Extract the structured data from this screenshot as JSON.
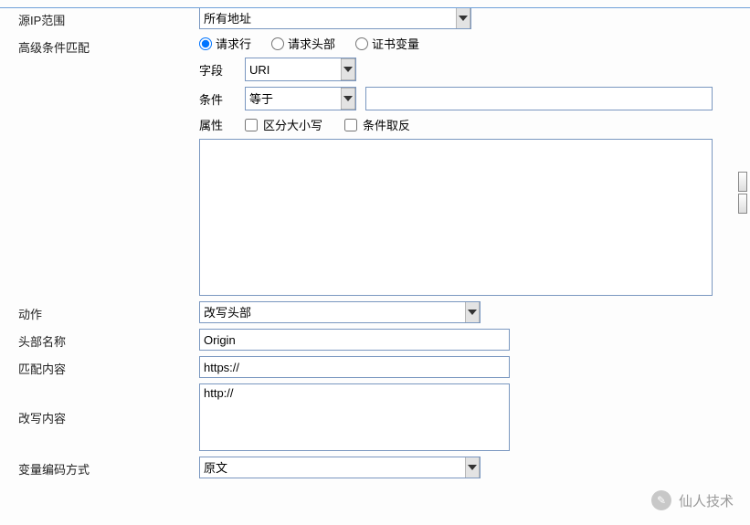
{
  "rows": {
    "ipRange": {
      "label": "源IP范围",
      "value": "所有地址"
    },
    "advMatch": {
      "label": "高级条件匹配",
      "radios": {
        "reqLine": "请求行",
        "reqHeader": "请求头部",
        "certVar": "证书变量"
      },
      "selectedRadio": "reqLine",
      "field": {
        "label": "字段",
        "value": "URI"
      },
      "cond": {
        "label": "条件",
        "value": "等于",
        "input": ""
      },
      "attr": {
        "label": "属性",
        "caseSensitive": "区分大小写",
        "negate": "条件取反"
      },
      "listbox": ""
    },
    "action": {
      "label": "动作",
      "value": "改写头部"
    },
    "headerName": {
      "label": "头部名称",
      "value": "Origin"
    },
    "matchText": {
      "label": "匹配内容",
      "value": "https://"
    },
    "rewrite": {
      "label": "改写内容",
      "value": "http://"
    },
    "encoding": {
      "label": "变量编码方式",
      "value": "原文"
    }
  },
  "watermark": {
    "text": "仙人技术"
  }
}
